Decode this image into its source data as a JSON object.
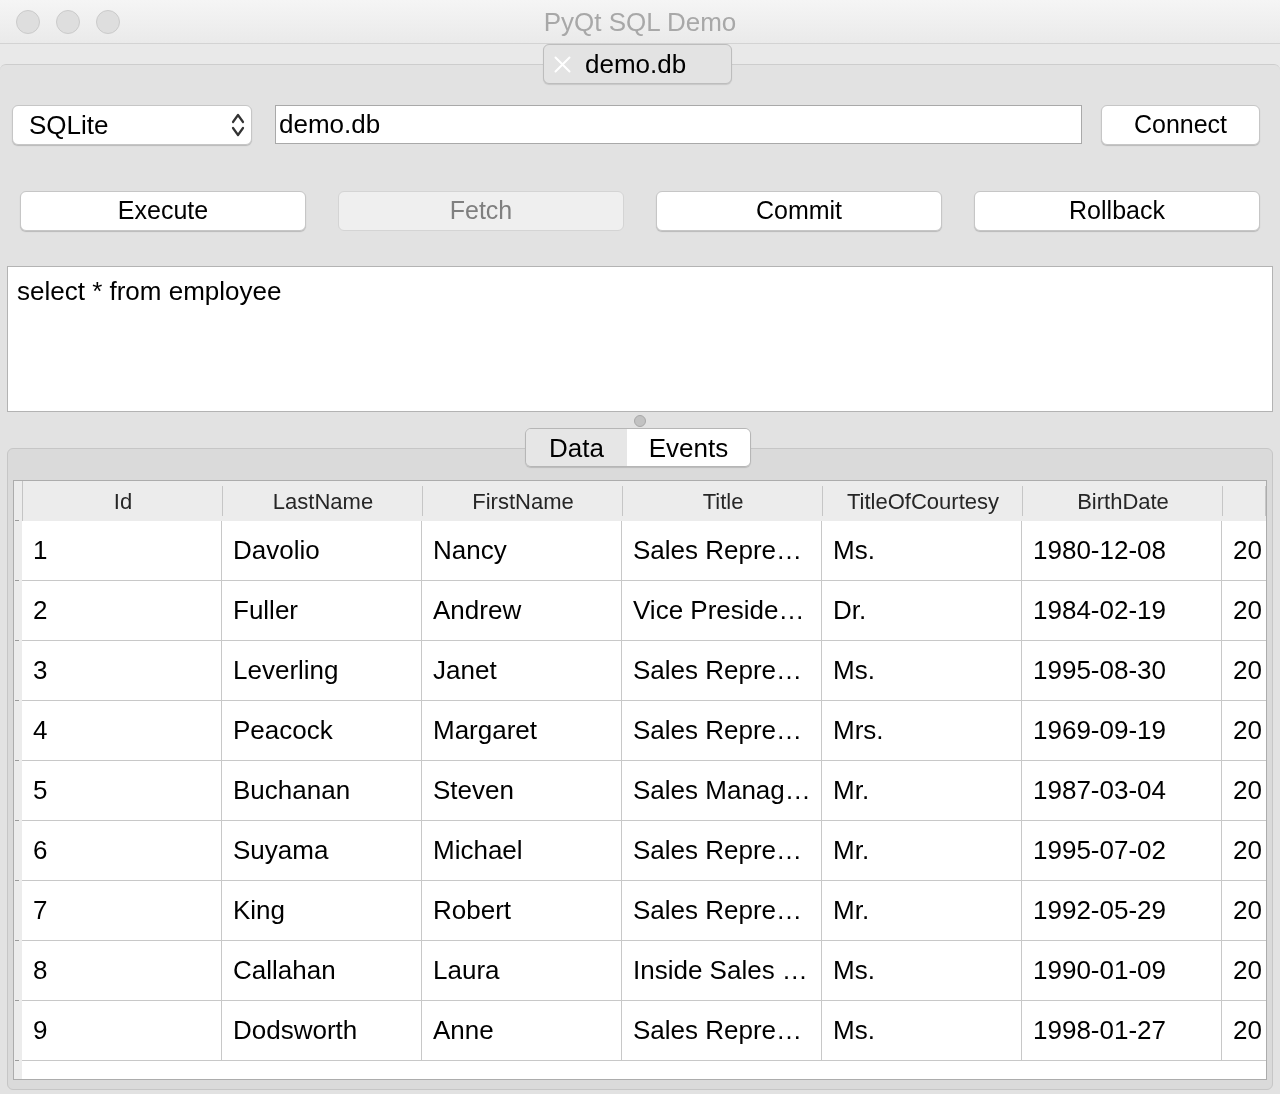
{
  "window": {
    "title": "PyQt SQL Demo"
  },
  "document_tabs": [
    {
      "label": "demo.db",
      "selected": true
    }
  ],
  "connection": {
    "driver": "SQLite",
    "database": "demo.db",
    "button": "Connect"
  },
  "actions": [
    {
      "label": "Execute",
      "disabled": false
    },
    {
      "label": "Fetch",
      "disabled": true
    },
    {
      "label": "Commit",
      "disabled": false
    },
    {
      "label": "Rollback",
      "disabled": false
    }
  ],
  "query_editor": {
    "text": "select * from employee"
  },
  "result_tabs": [
    {
      "label": "Data",
      "selected": true
    },
    {
      "label": "Events",
      "selected": false
    }
  ],
  "table": {
    "columns": [
      "Id",
      "LastName",
      "FirstName",
      "Title",
      "TitleOfCourtesy",
      "BirthDate"
    ],
    "rows": [
      [
        "1",
        "Davolio",
        "Nancy",
        "Sales Repre…",
        "Ms.",
        "1980-12-08",
        "20"
      ],
      [
        "2",
        "Fuller",
        "Andrew",
        "Vice Preside…",
        "Dr.",
        "1984-02-19",
        "20"
      ],
      [
        "3",
        "Leverling",
        "Janet",
        "Sales Repre…",
        "Ms.",
        "1995-08-30",
        "20"
      ],
      [
        "4",
        "Peacock",
        "Margaret",
        "Sales Repre…",
        "Mrs.",
        "1969-09-19",
        "20"
      ],
      [
        "5",
        "Buchanan",
        "Steven",
        "Sales Manag…",
        "Mr.",
        "1987-03-04",
        "20"
      ],
      [
        "6",
        "Suyama",
        "Michael",
        "Sales Repre…",
        "Mr.",
        "1995-07-02",
        "20"
      ],
      [
        "7",
        "King",
        "Robert",
        "Sales Repre…",
        "Mr.",
        "1992-05-29",
        "20"
      ],
      [
        "8",
        "Callahan",
        "Laura",
        "Inside Sales …",
        "Ms.",
        "1990-01-09",
        "20"
      ],
      [
        "9",
        "Dodsworth",
        "Anne",
        "Sales Repre…",
        "Ms.",
        "1998-01-27",
        "20"
      ]
    ]
  }
}
